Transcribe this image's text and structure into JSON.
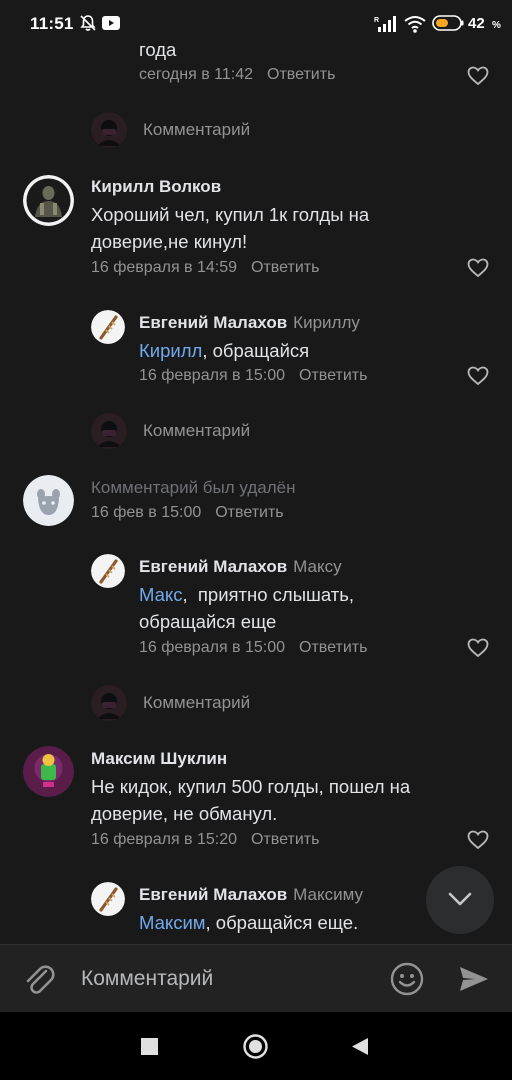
{
  "status_bar": {
    "time": "11:51",
    "battery_pct": "42",
    "pct_sign": "%"
  },
  "labels": {
    "reply": "Ответить",
    "comment_placeholder": "Комментарий"
  },
  "top_partial": {
    "text": "года",
    "time": "сегодня в 11:42"
  },
  "comment1": {
    "author": "Кирилл Волков",
    "text": "Хороший чел, купил 1к голды на доверие,не кинул!",
    "time": "16 февраля в 14:59"
  },
  "reply1": {
    "author": "Евгений Малахов",
    "reply_to": "Кириллу",
    "mention": "Кирилл",
    "text": ", обращайся",
    "time": "16 февраля в 15:00"
  },
  "comment2": {
    "deleted_text": "Комментарий был удалён",
    "time": "16 фев в 15:00"
  },
  "reply2": {
    "author": "Евгений Малахов",
    "reply_to": "Максу",
    "mention": "Макс",
    "text": ",  приятно слышать, обращайся еще",
    "time": "16 февраля в 15:00"
  },
  "comment3": {
    "author": "Максим Шуклин",
    "text": "Не кидок, купил 500 голды, пошел на доверие, не обманул.",
    "time": "16 февраля в 15:20"
  },
  "reply3": {
    "author": "Евгений Малахов",
    "reply_to": "Максиму",
    "mention": "Максим",
    "text": ", обращайся еще."
  },
  "colors": {
    "background": "#19191a",
    "link": "#71aaeb",
    "secondary": "#939393",
    "like": "#b8b9bb"
  }
}
